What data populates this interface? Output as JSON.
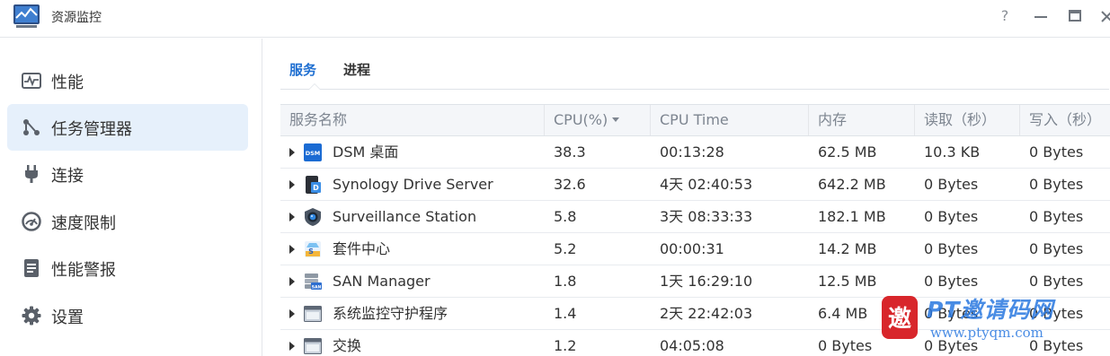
{
  "window": {
    "title": "资源监控",
    "help_glyph": "?",
    "minimize_glyph": "—",
    "maximize_glyph": "▭",
    "close_glyph": "×"
  },
  "sidebar": {
    "items": [
      {
        "label": "性能",
        "icon": "performance-icon",
        "active": false
      },
      {
        "label": "任务管理器",
        "icon": "task-manager-icon",
        "active": true
      },
      {
        "label": "连接",
        "icon": "plug-icon",
        "active": false
      },
      {
        "label": "速度限制",
        "icon": "speed-gauge-icon",
        "active": false
      },
      {
        "label": "性能警报",
        "icon": "alert-document-icon",
        "active": false
      },
      {
        "label": "设置",
        "icon": "gear-icon",
        "active": false
      }
    ]
  },
  "tabs": [
    {
      "label": "服务",
      "active": true
    },
    {
      "label": "进程",
      "active": false
    }
  ],
  "table": {
    "headers": [
      "服务名称",
      "CPU(%)",
      "CPU Time",
      "内存",
      "读取（秒）",
      "写入（秒）"
    ],
    "sorted_column": "CPU(%)",
    "rows": [
      {
        "name": "DSM 桌面",
        "icon": "dsm-icon",
        "cpu": "38.3",
        "cpu_time": "00:13:28",
        "memory": "62.5 MB",
        "read": "10.3 KB",
        "write": "0 Bytes"
      },
      {
        "name": "Synology Drive Server",
        "icon": "synology-drive-icon",
        "cpu": "32.6",
        "cpu_time": "4天 02:40:53",
        "memory": "642.2 MB",
        "read": "0 Bytes",
        "write": "0 Bytes"
      },
      {
        "name": "Surveillance Station",
        "icon": "surveillance-camera-icon",
        "cpu": "5.8",
        "cpu_time": "3天 08:33:33",
        "memory": "182.1 MB",
        "read": "0 Bytes",
        "write": "0 Bytes"
      },
      {
        "name": "套件中心",
        "icon": "package-center-icon",
        "cpu": "5.2",
        "cpu_time": "00:00:31",
        "memory": "14.2 MB",
        "read": "0 Bytes",
        "write": "0 Bytes"
      },
      {
        "name": "SAN Manager",
        "icon": "san-manager-icon",
        "cpu": "1.8",
        "cpu_time": "1天 16:29:10",
        "memory": "12.5 MB",
        "read": "0 Bytes",
        "write": "0 Bytes"
      },
      {
        "name": "系统监控守护程序",
        "icon": "window-icon",
        "cpu": "1.4",
        "cpu_time": "2天 22:42:03",
        "memory": "6.4 MB",
        "read": "0 Bytes",
        "write": "0 Bytes"
      },
      {
        "name": "交换",
        "icon": "window-icon",
        "cpu": "1.2",
        "cpu_time": "04:05:08",
        "memory": "0 Bytes",
        "read": "0 Bytes",
        "write": "0 Bytes"
      }
    ]
  },
  "watermark": {
    "logo_char": "邀",
    "brand": "PT邀请码网",
    "url": "www.ptyqm.com"
  },
  "colors": {
    "accent": "#1f6fd1",
    "active_item_bg": "#e6f0fb",
    "header_bg": "#f4f6f9",
    "watermark": "#2a78e0",
    "watermark_logo": "#d8262b"
  }
}
